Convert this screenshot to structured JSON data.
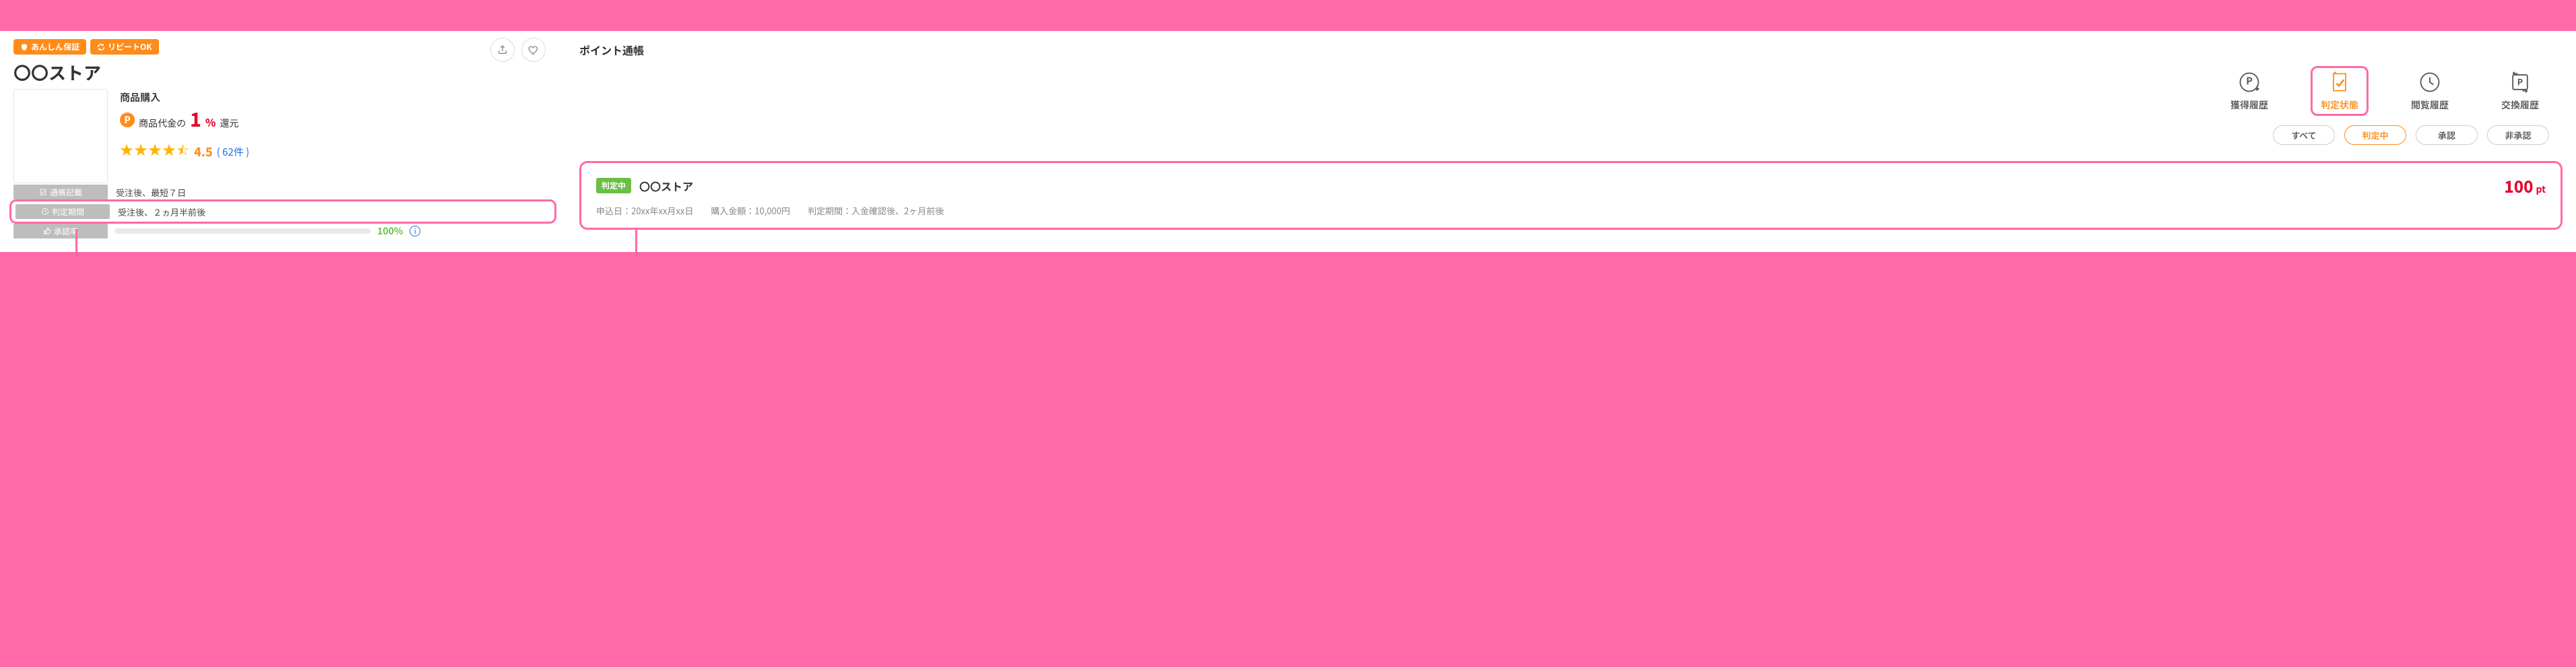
{
  "left": {
    "badges": {
      "assurance": "あんしん保証",
      "repeat": "リピートOK"
    },
    "store_name": "〇〇ストア",
    "purchase_type": "商品購入",
    "cashback": {
      "prefix": "商品代金の",
      "number": "1",
      "percent": "%",
      "suffix": "還元"
    },
    "rating": {
      "value": "4.5",
      "count_label": "( 62件 )"
    },
    "attrs": {
      "label_record": "通帳記載",
      "value_record": "受注後、最短７日",
      "label_period": "判定期間",
      "value_period": "受注後、２ヵ月半前後",
      "label_approval": "承認率"
    },
    "progress_pct": "100%"
  },
  "right": {
    "title": "ポイント通帳",
    "tabs": {
      "history": "獲得履歴",
      "judging": "判定状態",
      "viewed": "閲覧履歴",
      "exchange": "交換履歴"
    },
    "filters": {
      "all": "すべて",
      "judging": "判定中",
      "approved": "承認",
      "rejected": "非承認"
    },
    "txn": {
      "status": "判定中",
      "store": "〇〇ストア",
      "points": "100",
      "points_unit": "pt",
      "apply_date": "申込日：20xx年xx月xx日",
      "amount": "購入金額：10,000円",
      "period": "判定期間：入金確認後、2ヶ月前後"
    }
  },
  "icon_names": {
    "share": "share-icon",
    "heart": "heart-icon",
    "info": "info-icon"
  }
}
